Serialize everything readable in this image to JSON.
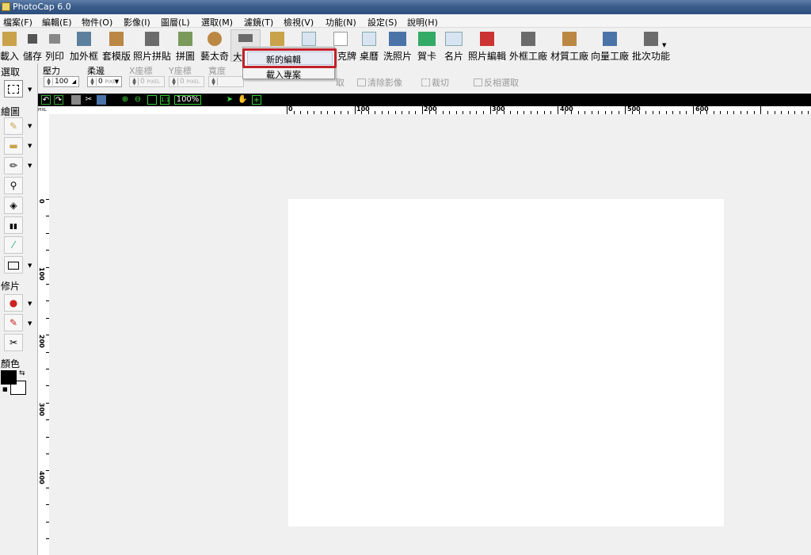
{
  "window": {
    "title": "PhotoCap 6.0"
  },
  "menu": [
    {
      "label": "檔案(F)"
    },
    {
      "label": "編輯(E)"
    },
    {
      "label": "物件(O)"
    },
    {
      "label": "影像(I)"
    },
    {
      "label": "圖層(L)"
    },
    {
      "label": "選取(M)"
    },
    {
      "label": "濾鏡(T)"
    },
    {
      "label": "檢視(V)"
    },
    {
      "label": "功能(N)"
    },
    {
      "label": "設定(S)"
    },
    {
      "label": "說明(H)"
    }
  ],
  "toolbar": [
    {
      "label": "載入",
      "icon": "open-folder-icon"
    },
    {
      "label": "儲存",
      "icon": "save-disk-icon"
    },
    {
      "label": "列印",
      "icon": "printer-icon"
    },
    {
      "label": "加外框",
      "icon": "frame-icon"
    },
    {
      "label": "套模版",
      "icon": "template-icon"
    },
    {
      "label": "照片拼貼",
      "icon": "collage-icon"
    },
    {
      "label": "拼圖",
      "icon": "puzzle-icon"
    },
    {
      "label": "藝太奇",
      "icon": "montage-icon"
    },
    {
      "label": "大",
      "icon": "big-head-icon"
    },
    {
      "label": "",
      "icon": "calendar-icon"
    },
    {
      "label": "",
      "icon": "book-icon"
    },
    {
      "label": "克牌",
      "icon": "poker-cards-icon"
    },
    {
      "label": "桌曆",
      "icon": "desk-calendar-icon"
    },
    {
      "label": "洗照片",
      "icon": "print-photo-icon"
    },
    {
      "label": "賀卡",
      "icon": "greeting-card-icon"
    },
    {
      "label": "名片",
      "icon": "business-card-icon"
    },
    {
      "label": "照片編輯",
      "icon": "photo-edit-icon"
    },
    {
      "label": "外框工廠",
      "icon": "frame-factory-icon"
    },
    {
      "label": "材質工廠",
      "icon": "texture-factory-icon"
    },
    {
      "label": "向量工廠",
      "icon": "vector-factory-icon"
    },
    {
      "label": "批次功能",
      "icon": "batch-icon"
    }
  ],
  "popup": {
    "items": [
      {
        "label": "新的編輯"
      },
      {
        "label": "載入專案"
      }
    ]
  },
  "options": {
    "pressure_label": "壓力",
    "pressure_value": "100",
    "soft_edge_label": "柔邊",
    "soft_edge_value": "0",
    "x_label": "X座標",
    "x_value": "0",
    "y_label": "Y座標",
    "y_value": "0",
    "width_label": "寬度",
    "unit": "PIXEL",
    "unit_short": "PIXL",
    "clear_image_label": "清除影像",
    "crop_label": "裁切",
    "invert_selection_label": "反相選取",
    "partial_hidden_label": "取"
  },
  "left_panel": {
    "select_label": "選取",
    "draw_label": "繪圖",
    "retouch_label": "修片",
    "color_label": "顏色"
  },
  "canvas_bar": {
    "zoom": "100%"
  },
  "ruler": {
    "h_labels": [
      "0",
      "100",
      "200",
      "300",
      "400",
      "500",
      "600"
    ],
    "v_labels": [
      "0",
      "100",
      "200",
      "300",
      "400"
    ]
  }
}
